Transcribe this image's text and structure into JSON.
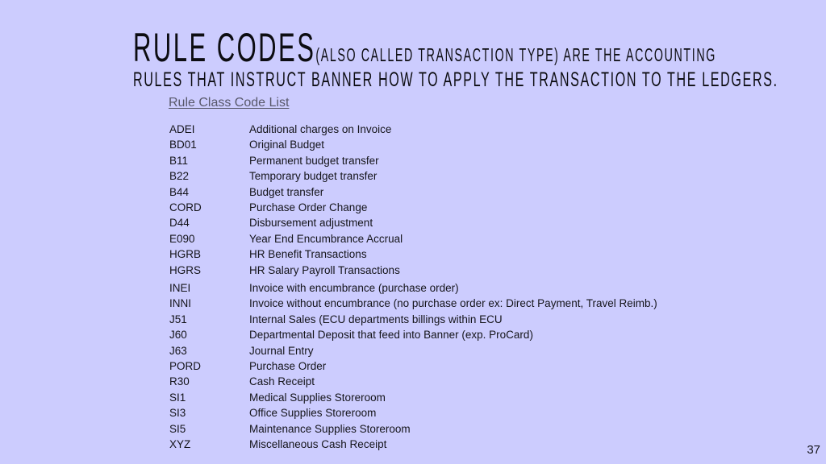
{
  "slide": {
    "background_color": "#ccccfe",
    "title": {
      "big": "RULE CODES",
      "small": "(ALSO CALLED TRANSACTION TYPE)  ARE THE ACCOUNTING",
      "line2": "RULES THAT INSTRUCT BANNER HOW TO APPLY THE TRANSACTION TO THE LEDGERS."
    },
    "link": {
      "label": "Rule Class Code List",
      "color": "#58586a"
    },
    "rule_codes": [
      {
        "code": "ADEI",
        "description": "Additional charges on Invoice"
      },
      {
        "code": "BD01",
        "description": "Original Budget"
      },
      {
        "code": "B11",
        "description": "Permanent budget transfer"
      },
      {
        "code": "B22",
        "description": "Temporary budget transfer"
      },
      {
        "code": "B44",
        "description": "Budget transfer"
      },
      {
        "code": "CORD",
        "description": "Purchase Order Change"
      },
      {
        "code": "D44",
        "description": "Disbursement adjustment"
      },
      {
        "code": "E090",
        "description": "Year End Encumbrance Accrual"
      },
      {
        "code": "HGRB",
        "description": "HR Benefit Transactions"
      },
      {
        "code": "HGRS",
        "description": "HR Salary Payroll Transactions"
      },
      {
        "code": "INEI",
        "description": "Invoice with encumbrance (purchase order)"
      },
      {
        "code": "INNI",
        "description": "Invoice without encumbrance (no purchase order ex: Direct Payment, Travel Reimb.)"
      },
      {
        "code": "J51",
        "description": "Internal Sales (ECU departments billings within ECU"
      },
      {
        "code": "J60",
        "description": "Departmental Deposit that feed into Banner (exp. ProCard)"
      },
      {
        "code": "J63",
        "description": "Journal Entry"
      },
      {
        "code": "PORD",
        "description": "Purchase Order"
      },
      {
        "code": "R30",
        "description": "Cash Receipt"
      },
      {
        "code": "SI1",
        "description": "Medical Supplies Storeroom"
      },
      {
        "code": "SI3",
        "description": "Office Supplies Storeroom"
      },
      {
        "code": "SI5",
        "description": "Maintenance Supplies Storeroom"
      },
      {
        "code": "XYZ",
        "description": "Miscellaneous Cash Receipt"
      }
    ],
    "page_number": "37"
  }
}
